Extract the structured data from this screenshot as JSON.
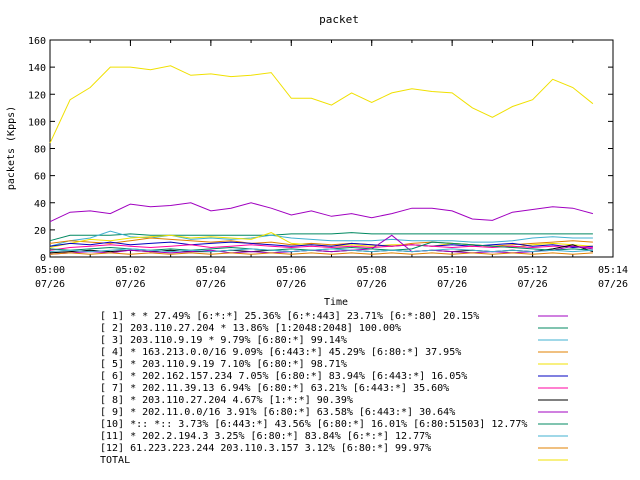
{
  "chart_data": {
    "type": "line",
    "title": "packet",
    "xlabel": "Time",
    "ylabel": "packets (Kpps)",
    "ylim": [
      0,
      160
    ],
    "yticks": [
      "0",
      "20",
      "40",
      "60",
      "80",
      "100",
      "120",
      "140",
      "160"
    ],
    "xlim": [
      "05:00",
      "05:14"
    ],
    "xticks": [
      {
        "time": "05:00",
        "date": "07/26"
      },
      {
        "time": "05:02",
        "date": "07/26"
      },
      {
        "time": "05:04",
        "date": "07/26"
      },
      {
        "time": "05:06",
        "date": "07/26"
      },
      {
        "time": "05:08",
        "date": "07/26"
      },
      {
        "time": "05:10",
        "date": "07/26"
      },
      {
        "time": "05:12",
        "date": "07/26"
      },
      {
        "time": "05:14",
        "date": "07/26"
      }
    ],
    "grid": false,
    "legend_position": "bottom",
    "x": [
      "05:00",
      "05:00:30",
      "05:01",
      "05:01:30",
      "05:02",
      "05:02:30",
      "05:03",
      "05:03:30",
      "05:04",
      "05:04:30",
      "05:05",
      "05:05:30",
      "05:06",
      "05:06:30",
      "05:07",
      "05:07:30",
      "05:08",
      "05:08:30",
      "05:09",
      "05:09:30",
      "05:10",
      "05:10:30",
      "05:11",
      "05:11:30",
      "05:12",
      "05:12:30",
      "05:13",
      "05:13:30"
    ],
    "series": [
      {
        "name": "[ 1] * * 27.49%  [6:*:*] 25.36% [6:*:443] 23.71% [6:*:80] 20.15%",
        "color": "#a000c0",
        "values": [
          26,
          33,
          34,
          32,
          39,
          37,
          38,
          40,
          34,
          36,
          40,
          36,
          31,
          34,
          30,
          32,
          29,
          32,
          36,
          36,
          34,
          28,
          27,
          33,
          35,
          37,
          36,
          32
        ]
      },
      {
        "name": "[ 2] 203.110.27.204 * 13.86%  [1:2048:2048] 100.00%",
        "color": "#008860",
        "values": [
          12,
          16,
          16,
          16,
          17,
          16,
          16,
          16,
          16,
          16,
          16,
          16,
          17,
          17,
          17,
          18,
          17,
          17,
          17,
          17,
          17,
          17,
          17,
          17,
          17,
          17,
          17,
          17
        ]
      },
      {
        "name": "[ 3] 203.110.9.19 * 9.79%  [6:80:*] 99.14%",
        "color": "#40b0d0",
        "values": [
          8,
          12,
          14,
          19,
          15,
          14,
          16,
          13,
          14,
          13,
          14,
          16,
          14,
          13,
          12,
          12,
          12,
          13,
          12,
          12,
          12,
          11,
          11,
          12,
          14,
          15,
          14,
          14
        ]
      },
      {
        "name": "[ 4] * 163.213.0.0/16 9.09%  [6:443:*] 45.29% [6:80:*] 37.95%",
        "color": "#e08000",
        "values": [
          10,
          12,
          11,
          10,
          12,
          14,
          13,
          12,
          11,
          12,
          10,
          11,
          9,
          10,
          9,
          10,
          9,
          8,
          10,
          11,
          10,
          9,
          8,
          9,
          10,
          11,
          12,
          11
        ]
      },
      {
        "name": "[ 5] * 203.110.9.19 7.10%  [6:80:*] 98.71%",
        "color": "#f0e000",
        "values": [
          7,
          10,
          13,
          12,
          14,
          15,
          16,
          14,
          15,
          14,
          13,
          18,
          10,
          9,
          8,
          9,
          8,
          9,
          9,
          8,
          10,
          9,
          8,
          7,
          9,
          10,
          9,
          8
        ]
      },
      {
        "name": "[ 6] * 202.162.157.234 7.05%  [6:80:*] 83.94% [6:443:*] 16.05%",
        "color": "#0000c0",
        "values": [
          8,
          10,
          9,
          11,
          9,
          10,
          11,
          9,
          10,
          11,
          10,
          9,
          8,
          9,
          8,
          10,
          9,
          8,
          9,
          8,
          9,
          8,
          9,
          10,
          8,
          9,
          7,
          8
        ]
      },
      {
        "name": "[ 7] * 202.11.39.13 6.94%  [6:80:*] 63.21% [6:443:*] 35.60%",
        "color": "#ff00a0",
        "values": [
          5,
          7,
          8,
          9,
          8,
          7,
          8,
          9,
          7,
          8,
          9,
          8,
          7,
          8,
          7,
          8,
          7,
          8,
          9,
          8,
          7,
          8,
          7,
          8,
          7,
          8,
          8,
          7
        ]
      },
      {
        "name": "[ 8] * 203.110.27.204 4.67%  [1:*:*] 90.39%",
        "color": "#000000",
        "values": [
          3,
          4,
          5,
          4,
          5,
          4,
          5,
          4,
          4,
          5,
          4,
          5,
          4,
          5,
          4,
          5,
          4,
          5,
          4,
          5,
          4,
          5,
          4,
          5,
          4,
          6,
          9,
          4
        ]
      },
      {
        "name": "[ 9] * 202.11.0.0/16 3.91%  [6:80:*] 63.58% [6:443:*] 30.64%",
        "color": "#a000c0",
        "values": [
          2,
          3,
          4,
          3,
          5,
          4,
          3,
          4,
          5,
          3,
          4,
          3,
          4,
          5,
          4,
          5,
          6,
          16,
          4,
          5,
          4,
          3,
          4,
          3,
          4,
          5,
          8,
          6
        ]
      },
      {
        "name": "[10] *:: *:: 3.73%  [6:443:*] 43.56% [6:80:*] 16.01% [6:80:51503] 12.77%",
        "color": "#008860",
        "values": [
          6,
          5,
          6,
          7,
          6,
          5,
          6,
          5,
          6,
          7,
          6,
          5,
          6,
          5,
          6,
          7,
          6,
          5,
          6,
          11,
          10,
          9,
          8,
          7,
          6,
          5,
          6,
          5
        ]
      },
      {
        "name": "[11] * 202.2.194.3 3.25%  [6:80:*] 83.84% [6:*:*] 12.77%",
        "color": "#40b0d0",
        "values": [
          4,
          5,
          4,
          5,
          6,
          5,
          4,
          5,
          4,
          5,
          6,
          5,
          4,
          5,
          6,
          5,
          4,
          5,
          4,
          5,
          6,
          5,
          4,
          5,
          4,
          5,
          4,
          5
        ]
      },
      {
        "name": "[12] 61.223.223.244 203.110.3.157 3.12%  [6:80:*] 99.97%",
        "color": "#e08000",
        "values": [
          2,
          3,
          2,
          3,
          2,
          3,
          2,
          3,
          2,
          3,
          2,
          3,
          2,
          3,
          2,
          3,
          2,
          3,
          2,
          3,
          2,
          3,
          2,
          3,
          2,
          3,
          2,
          3
        ]
      },
      {
        "name": "TOTAL",
        "color": "#f0e000",
        "values": [
          84,
          116,
          125,
          140,
          140,
          138,
          141,
          134,
          135,
          133,
          134,
          136,
          117,
          117,
          112,
          121,
          114,
          121,
          124,
          122,
          121,
          110,
          103,
          111,
          116,
          131,
          125,
          113
        ]
      }
    ]
  }
}
